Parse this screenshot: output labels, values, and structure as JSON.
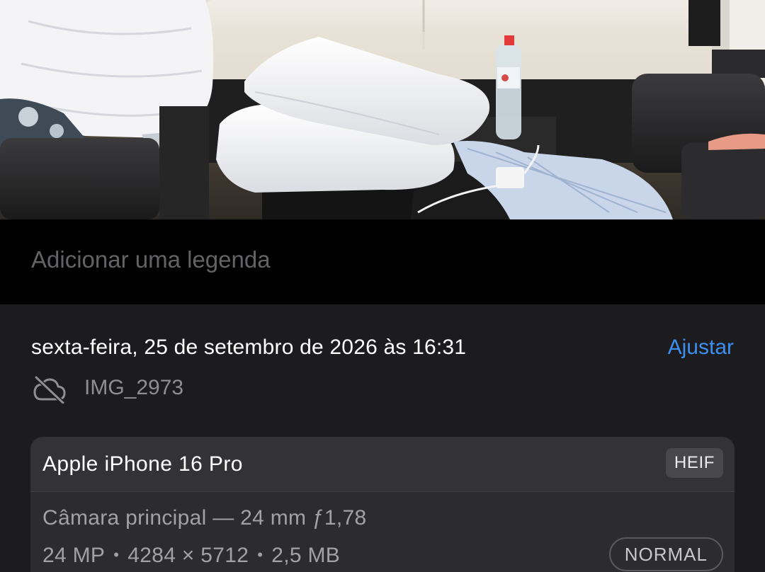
{
  "photo": {
    "description_icon": "photo-thumbnail"
  },
  "caption": {
    "placeholder": "Adicionar uma legenda",
    "value": ""
  },
  "info": {
    "date_time": "sexta-feira, 25 de setembro de 2026 às 16:31",
    "adjust_label": "Ajustar",
    "cloud_icon": "cloud-slash-icon",
    "filename": "IMG_2973"
  },
  "camera": {
    "device": "Apple iPhone 16 Pro",
    "format": "HEIF",
    "lens": "Câmara principal — 24 mm ƒ1,78",
    "resolution": "24 MP",
    "dimensions": "4284 × 5712",
    "size": "2,5 MB",
    "mode": "NORMAL"
  },
  "colors": {
    "accent": "#3d8ff0",
    "panel": "#1c1c1e",
    "card": "#2c2c2e"
  }
}
